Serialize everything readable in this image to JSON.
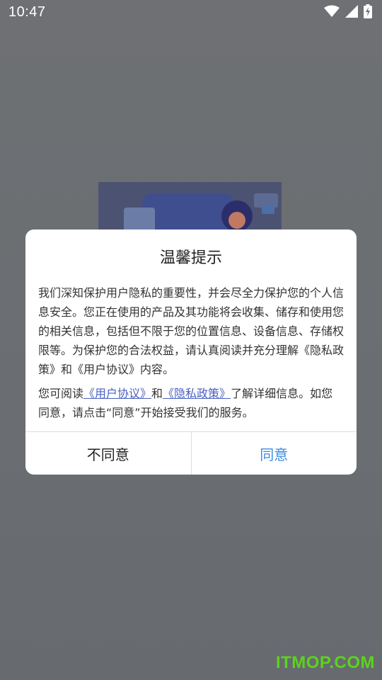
{
  "status_bar": {
    "time": "10:47",
    "icons": [
      "wifi-icon",
      "signal-icon",
      "battery-charging-icon"
    ]
  },
  "dialog": {
    "title": "温馨提示",
    "paragraph1": "我们深知保护用户隐私的重要性，并会尽全力保护您的个人信息安全。您正在使用的产品及其功能将会收集、储存和使用您的相关信息，包括但不限于您的位置信息、设备信息、存储权限等。为保护您的合法权益，请认真阅读并充分理解《隐私政 策》和《用户协议》内容。",
    "paragraph2_prefix": "您可阅读",
    "user_agreement_link": "《用户协议》",
    "paragraph2_and": "和",
    "privacy_policy_link": "《隐私政策》",
    "paragraph2_suffix": "了解详细信息。如您同意，请点击“同意”开始接受我们的服务。",
    "disagree_label": "不同意",
    "agree_label": "同意"
  },
  "watermark": "ITMOP.COM",
  "colors": {
    "overlay": "#6e7174",
    "link": "#4a5fc1",
    "agree": "#3a8de0",
    "watermark": "#5bd31c"
  }
}
